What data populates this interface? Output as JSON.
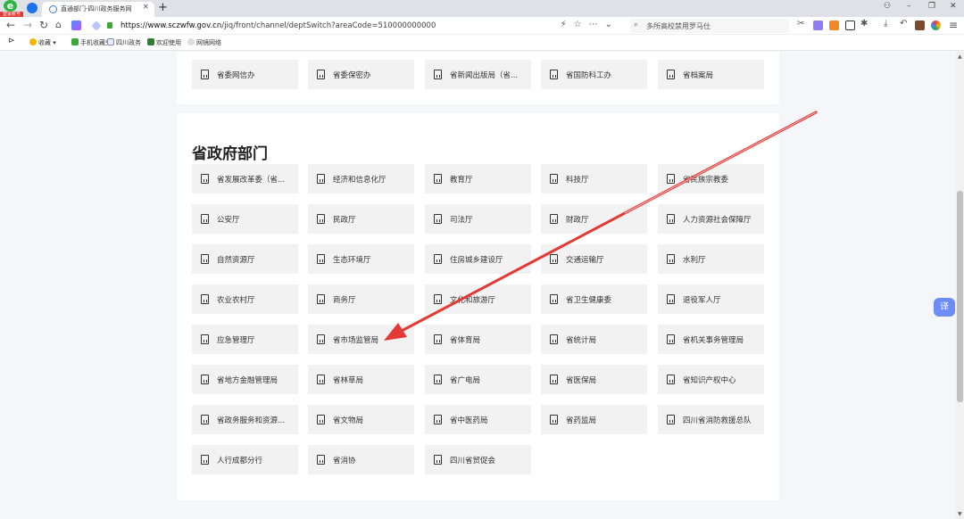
{
  "browser": {
    "badge_text": "登录账号",
    "tab_title": "直通部门-四川政务服务网",
    "url_host": "https://www.sczwfw.gov.cn",
    "url_path": "/jiq/front/channel/deptSwitch?areaCode=510000000000",
    "search_placeholder": "多所高校禁用罗马仕",
    "bookmarks": [
      "收藏",
      "手机收藏夹",
      "四川政务",
      "欢迎使用",
      "网镜网络"
    ]
  },
  "top_row": [
    "省委网信办",
    "省委保密办",
    "省新闻出版局（省...",
    "省国防科工办",
    "省档案局"
  ],
  "section": {
    "title": "省政府部门",
    "items": [
      "省发展改革委（省...",
      "经济和信息化厅",
      "教育厅",
      "科技厅",
      "省民族宗教委",
      "公安厅",
      "民政厅",
      "司法厅",
      "财政厅",
      "人力资源社会保障厅",
      "自然资源厅",
      "生态环境厅",
      "住房城乡建设厅",
      "交通运输厅",
      "水利厅",
      "农业农村厅",
      "商务厅",
      "文化和旅游厅",
      "省卫生健康委",
      "退役军人厅",
      "应急管理厅",
      "省市场监管局",
      "省体育局",
      "省统计局",
      "省机关事务管理局",
      "省地方金融管理局",
      "省林草局",
      "省广电局",
      "省医保局",
      "省知识产权中心",
      "省政务服务和资源...",
      "省文物局",
      "省中医药局",
      "省药监局",
      "四川省消防救援总队",
      "人行成都分行",
      "省消协",
      "四川省贸促会"
    ]
  },
  "float_button": "译",
  "colors": {
    "arrow": "#e53935",
    "accent": "#6d8cf5"
  }
}
